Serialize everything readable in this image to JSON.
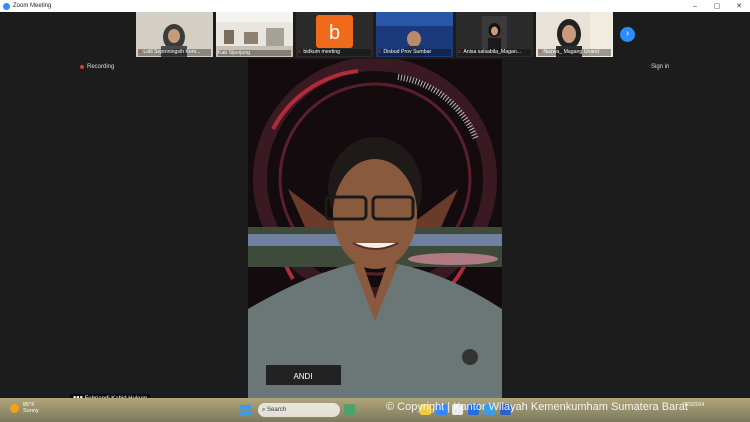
{
  "window": {
    "title": "Zoom Meeting",
    "controls": {
      "minimize": "–",
      "maximize": "▢",
      "close": "✕"
    }
  },
  "gallery": {
    "participants": [
      {
        "name": "Lolli Septriningsih Kem..."
      },
      {
        "name": "Kab Sijunjung"
      },
      {
        "name": "bidkum meeting",
        "avatar_letter": "b"
      },
      {
        "name": "Disbud Prov Sumbar"
      },
      {
        "name": "Anisa salsabila_Magan..."
      },
      {
        "name": "Nazwa_ Magang Unand"
      }
    ],
    "next_icon": "›"
  },
  "recording": {
    "label": "Recording"
  },
  "signin": {
    "label": "Sign in"
  },
  "speaker": {
    "display_name": "Febriandi Kabid Hukum",
    "badge_text": "ANDI"
  },
  "taskbar": {
    "weather_temp": "85°F",
    "weather_desc": "Sunny",
    "search_label": "Search",
    "date": "7/23/2024",
    "watermark": "© Copyright | Kantor Wilayah Kemenkumham Sumatera Barat"
  },
  "colors": {
    "accent": "#2d8cff",
    "recording": "#e0373a"
  }
}
